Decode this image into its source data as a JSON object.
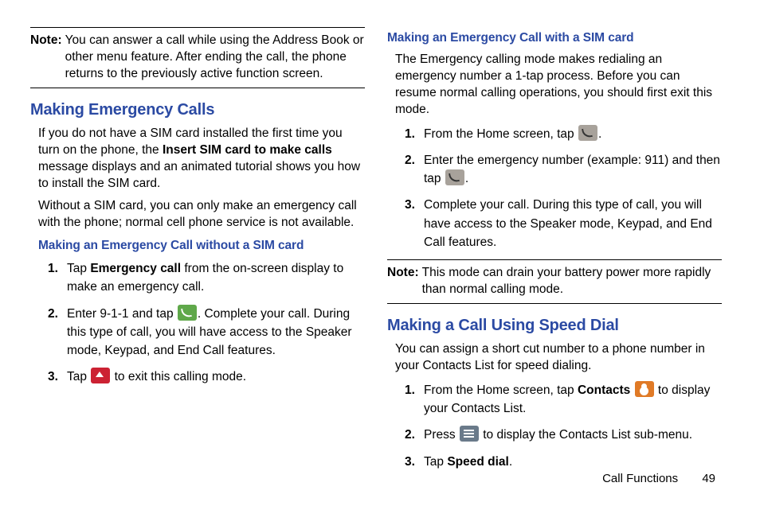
{
  "col1": {
    "note_label": "Note:",
    "note_body": "You can answer a call while using the Address Book or other menu feature. After ending the call, the phone returns to the previously active function screen.",
    "h_emerg": "Making Emergency Calls",
    "p1a": "If you do not have a SIM card installed the first time you turn on the phone, the ",
    "p1b": "Insert SIM card to make calls",
    "p1c": " message displays and an animated tutorial shows you how to install the SIM card.",
    "p2": "Without a SIM card, you can only make an emergency call with the phone; normal cell phone service is not available.",
    "h_no_sim": "Making an Emergency Call without a SIM card",
    "steps": {
      "s1a": "Tap ",
      "s1b": "Emergency call",
      "s1c": " from the on-screen display to make an emergency call.",
      "s2a": "Enter 9-1-1 and tap ",
      "s2b": ". Complete your call. During this type of call, you will have access to the Speaker mode, Keypad, and End Call features.",
      "s3a": "Tap ",
      "s3b": " to exit this calling mode."
    }
  },
  "col2": {
    "h_with_sim": "Making an Emergency Call with a SIM card",
    "p1": "The Emergency calling mode makes redialing an emergency number a 1-tap process. Before you can resume normal calling operations, you should first exit this mode.",
    "steps1": {
      "s1a": "From the Home screen, tap ",
      "s1b": ".",
      "s2a": "Enter the emergency number (example: 911) and then tap ",
      "s2b": ".",
      "s3": "Complete your call. During this type of call, you will have access to the Speaker mode, Keypad, and End Call features."
    },
    "note_label": "Note:",
    "note_body": "This mode can drain your battery power more rapidly than normal calling mode.",
    "h_speed": "Making a Call Using Speed Dial",
    "p_speed": "You can assign a short cut number to a phone number in your Contacts List for speed dialing.",
    "steps2": {
      "s1a": "From the Home screen, tap ",
      "s1b": "Contacts",
      "s1c": " to display your Contacts List.",
      "s2a": "Press ",
      "s2b": " to display the Contacts List sub-menu.",
      "s3a": "Tap ",
      "s3b": "Speed dial",
      "s3c": "."
    }
  },
  "footer": {
    "section": "Call Functions",
    "page": "49"
  },
  "nums": {
    "n1": "1.",
    "n2": "2.",
    "n3": "3."
  }
}
